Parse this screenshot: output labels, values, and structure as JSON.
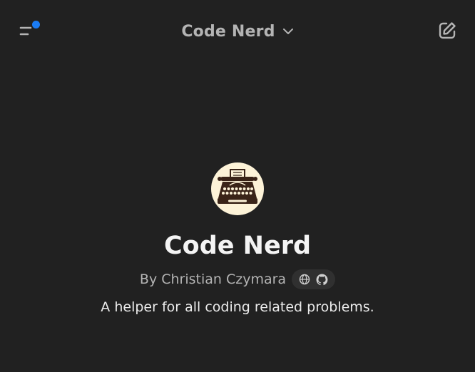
{
  "header": {
    "model_name": "Code Nerd"
  },
  "profile": {
    "name": "Code Nerd",
    "author": "By Christian Czymara",
    "description": "A helper for all coding related problems."
  },
  "icons": {
    "menu": "sidebar-menu-icon",
    "notification": "notification-dot",
    "chevron": "chevron-down-icon",
    "new_chat": "new-chat-edit-icon",
    "avatar": "typewriter-icon",
    "website": "globe-icon",
    "github": "github-icon"
  },
  "colors": {
    "background": "#212121",
    "accent_dot": "#1a7cf5",
    "avatar_bg": "#fdf3d8",
    "pill_bg": "#303030"
  }
}
